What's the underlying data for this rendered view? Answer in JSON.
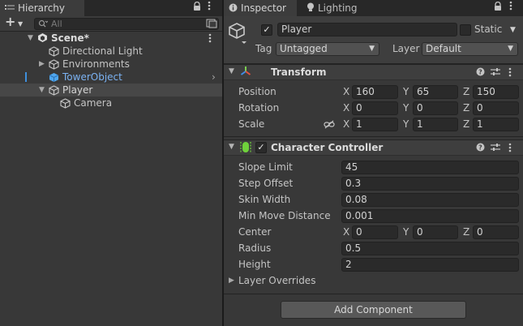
{
  "hierarchy": {
    "tab_label": "Hierarchy",
    "search_placeholder": "All",
    "add_label": "+",
    "items": [
      {
        "label": "Scene*"
      },
      {
        "label": "Directional Light"
      },
      {
        "label": "Environments"
      },
      {
        "label": "TowerObject"
      },
      {
        "label": "Player"
      },
      {
        "label": "Camera"
      }
    ]
  },
  "inspector": {
    "tabs": [
      {
        "label": "Inspector"
      },
      {
        "label": "Lighting"
      }
    ],
    "gameobject": {
      "name": "Player",
      "active": true,
      "static_label": "Static",
      "tag_label": "Tag",
      "tag_value": "Untagged",
      "layer_label": "Layer",
      "layer_value": "Default"
    },
    "transform": {
      "title": "Transform",
      "position_label": "Position",
      "rotation_label": "Rotation",
      "scale_label": "Scale",
      "axis_x": "X",
      "axis_y": "Y",
      "axis_z": "Z",
      "position": {
        "x": "160",
        "y": "65",
        "z": "150"
      },
      "rotation": {
        "x": "0",
        "y": "0",
        "z": "0"
      },
      "scale": {
        "x": "1",
        "y": "1",
        "z": "1"
      }
    },
    "character_controller": {
      "title": "Character Controller",
      "enabled": true,
      "slope_limit_label": "Slope Limit",
      "slope_limit": "45",
      "step_offset_label": "Step Offset",
      "step_offset": "0.3",
      "skin_width_label": "Skin Width",
      "skin_width": "0.08",
      "min_move_label": "Min Move Distance",
      "min_move": "0.001",
      "center_label": "Center",
      "center": {
        "x": "0",
        "y": "0",
        "z": "0"
      },
      "radius_label": "Radius",
      "radius": "0.5",
      "height_label": "Height",
      "height": "2",
      "layer_overrides_label": "Layer Overrides"
    },
    "add_component_label": "Add Component"
  },
  "colors": {
    "selected_text": "#7bb2f2",
    "tower_cube": "#4ea6ee",
    "controller_icon": "#6fd13b",
    "transform_x": "#e2513f",
    "transform_y": "#7cd152",
    "transform_z": "#3f8ee8"
  }
}
